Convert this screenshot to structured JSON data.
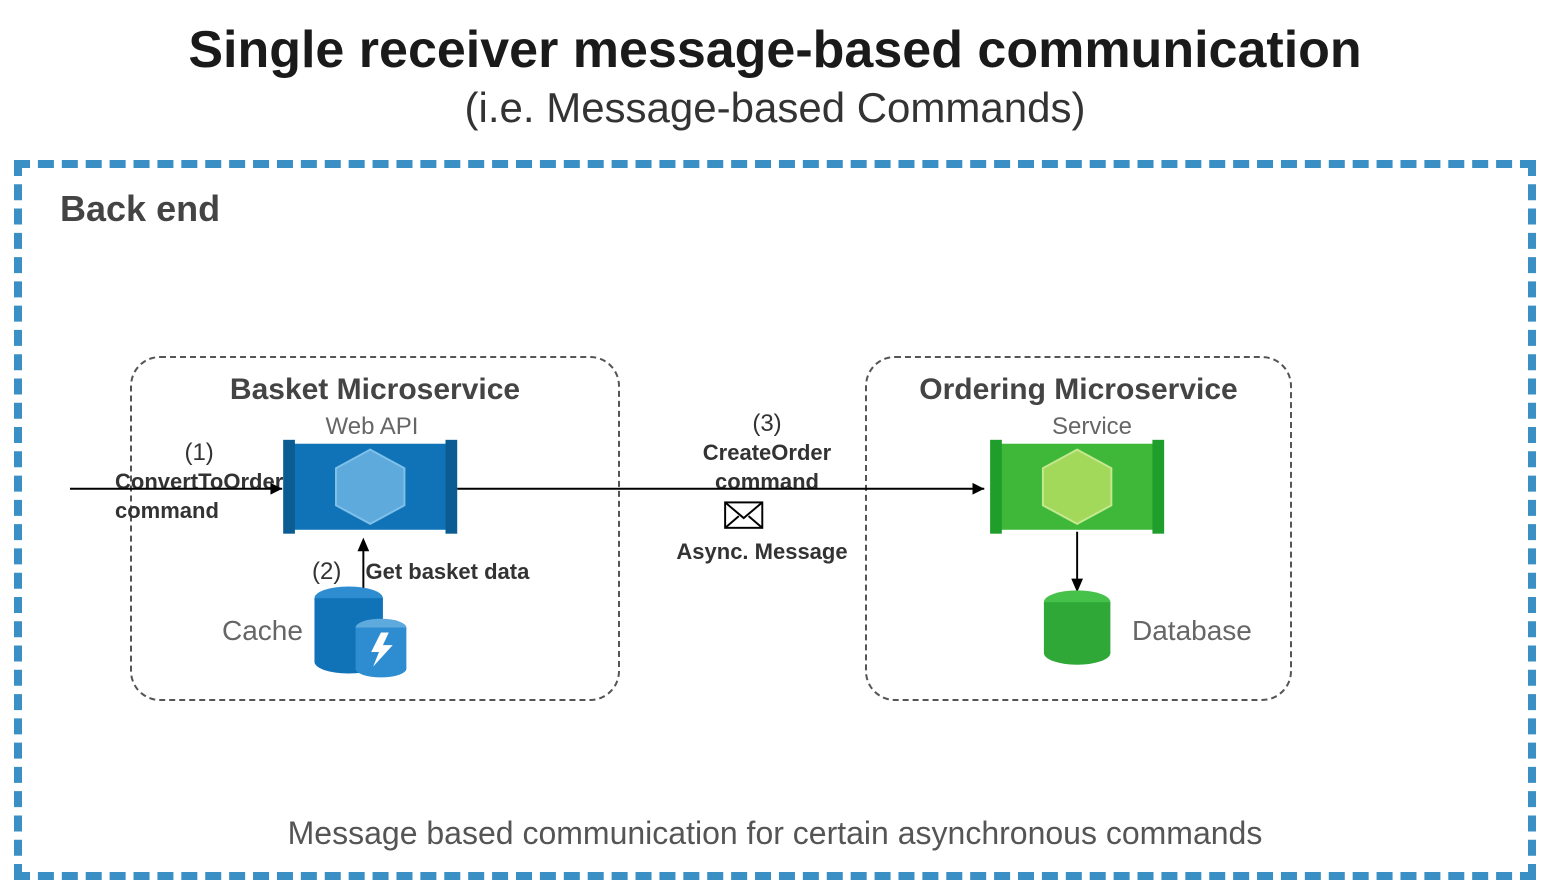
{
  "title": "Single receiver message-based communication",
  "subtitle": "(i.e. Message-based Commands)",
  "backend_label": "Back end",
  "caption": "Message based communication for certain asynchronous commands",
  "basket": {
    "title": "Basket Microservice",
    "service_label": "Web API",
    "store_label": "Cache"
  },
  "ordering": {
    "title": "Ordering Microservice",
    "service_label": "Service",
    "store_label": "Database"
  },
  "steps": {
    "one_num": "(1)",
    "one_text": "ConvertToOrder command",
    "two_num": "(2)",
    "two_text": "Get basket data",
    "three_num": "(3)",
    "three_text_top": "CreateOrder command",
    "three_text_bottom": "Async. Message"
  },
  "colors": {
    "blue_dark": "#1073b8",
    "blue_mid": "#2e8cd1",
    "blue_light": "#5eaadd",
    "green_dark": "#1f9e2b",
    "green_mid": "#3fb83a",
    "green_light": "#86c94a",
    "green_db": "#2fa838"
  }
}
